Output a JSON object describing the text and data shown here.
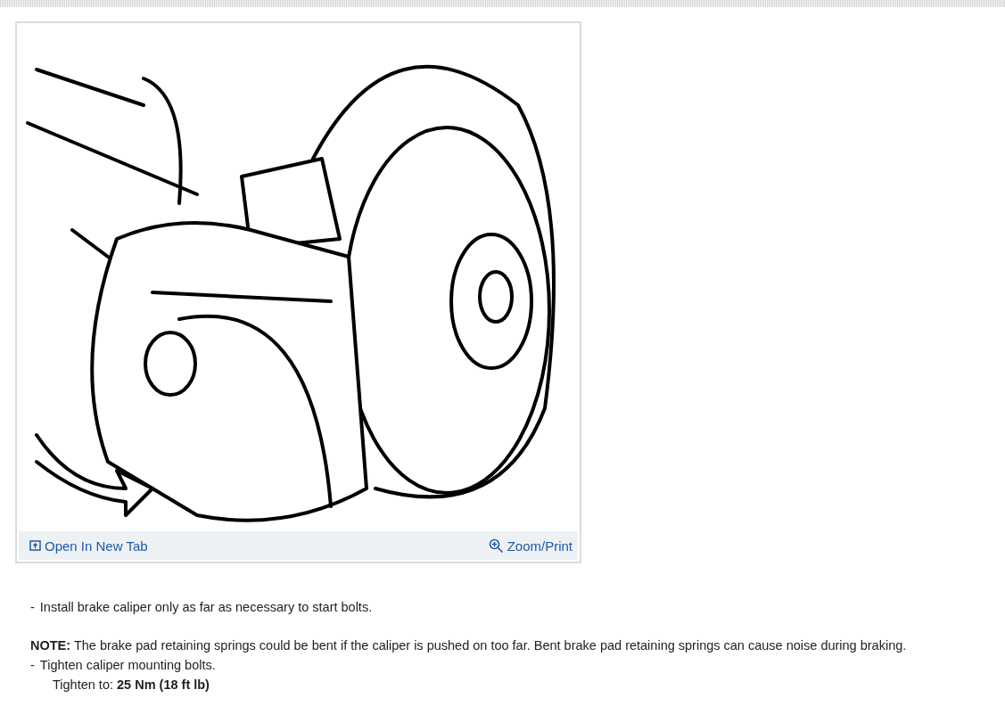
{
  "figure": {
    "open_link": "Open In New Tab",
    "zoom_link": "Zoom/Print"
  },
  "steps": [
    {
      "kind": "step",
      "marker": "-",
      "text": "Install brake caliper only as far as necessary to start bolts."
    },
    {
      "kind": "note",
      "text": "**NOTE:** The brake pad retaining springs could be bent if the caliper is pushed on too far. Bent brake pad retaining springs can cause noise during braking."
    },
    {
      "kind": "step",
      "marker": "-",
      "text": "Tighten caliper mounting bolts."
    },
    {
      "kind": "spec",
      "text": "Tighten to: **25 Nm (18 ft lb)**"
    }
  ]
}
